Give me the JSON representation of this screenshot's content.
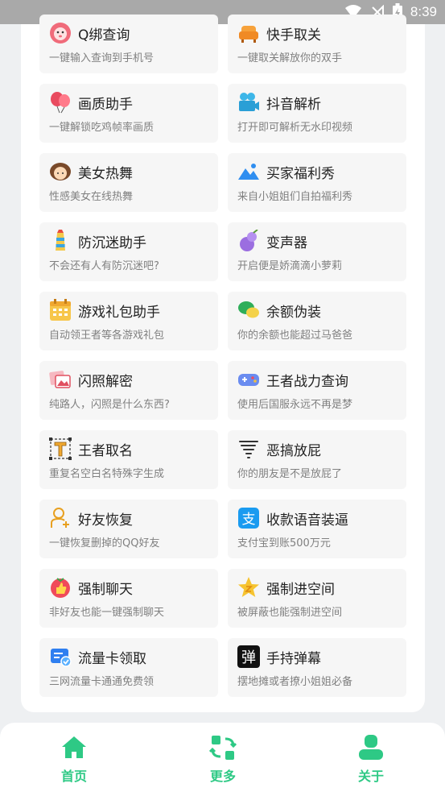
{
  "status_bar": {
    "time": "8:39",
    "icons": [
      "wifi-icon",
      "no-signal-icon",
      "battery-charging-icon"
    ]
  },
  "cards": [
    {
      "title": "Q绑查询",
      "desc": "一键输入查询到手机号",
      "icon": "lion-icon"
    },
    {
      "title": "快手取关",
      "desc": "一键取关解放你的双手",
      "icon": "sofa-icon"
    },
    {
      "title": "画质助手",
      "desc": "一键解锁吃鸡帧率画质",
      "icon": "balloons-icon"
    },
    {
      "title": "抖音解析",
      "desc": "打开即可解析无水印视频",
      "icon": "video-camera-icon"
    },
    {
      "title": "美女热舞",
      "desc": "性感美女在线热舞",
      "icon": "girl-icon"
    },
    {
      "title": "买家福利秀",
      "desc": "来自小姐姐们自拍福利秀",
      "icon": "photo-icon"
    },
    {
      "title": "防沉迷助手",
      "desc": "不会还有人有防沉迷吧?",
      "icon": "lighthouse-icon"
    },
    {
      "title": "变声器",
      "desc": "开启便是娇滴滴小萝莉",
      "icon": "gourd-icon"
    },
    {
      "title": "游戏礼包助手",
      "desc": "自动领王者等各游戏礼包",
      "icon": "calendar-icon"
    },
    {
      "title": "余额伪装",
      "desc": "你的余额也能超过马爸爸",
      "icon": "wechat-icon"
    },
    {
      "title": "闪照解密",
      "desc": "纯路人，闪照是什么东西?",
      "icon": "photos-icon"
    },
    {
      "title": "王者战力查询",
      "desc": "使用后国服永远不再是梦",
      "icon": "gamepad-icon"
    },
    {
      "title": "王者取名",
      "desc": "重复名空白名特殊字生成",
      "icon": "text-tool-icon"
    },
    {
      "title": "恶搞放屁",
      "desc": "你的朋友是不是放屁了",
      "icon": "tornado-icon"
    },
    {
      "title": "好友恢复",
      "desc": "一键恢复删掉的QQ好友",
      "icon": "add-user-icon"
    },
    {
      "title": "收款语音装逼",
      "desc": "支付宝到账500万元",
      "icon": "alipay-icon"
    },
    {
      "title": "强制聊天",
      "desc": "非好友也能一键强制聊天",
      "icon": "thumbs-up-icon"
    },
    {
      "title": "强制进空间",
      "desc": "被屏蔽也能强制进空间",
      "icon": "star-icon"
    },
    {
      "title": "流量卡领取",
      "desc": "三网流量卡通通免费领",
      "icon": "card-check-icon"
    },
    {
      "title": "手持弹幕",
      "desc": "摆地摊或者撩小姐姐必备",
      "icon": "danmu-icon"
    }
  ],
  "nav": [
    {
      "label": "首页",
      "icon": "home-icon"
    },
    {
      "label": "更多",
      "icon": "refresh-grid-icon"
    },
    {
      "label": "关于",
      "icon": "user-icon"
    }
  ],
  "colors": {
    "accent": "#2ec985",
    "background": "#eef0f2",
    "card": "#f6f6f6",
    "status_bar": "#a9a9a9"
  }
}
